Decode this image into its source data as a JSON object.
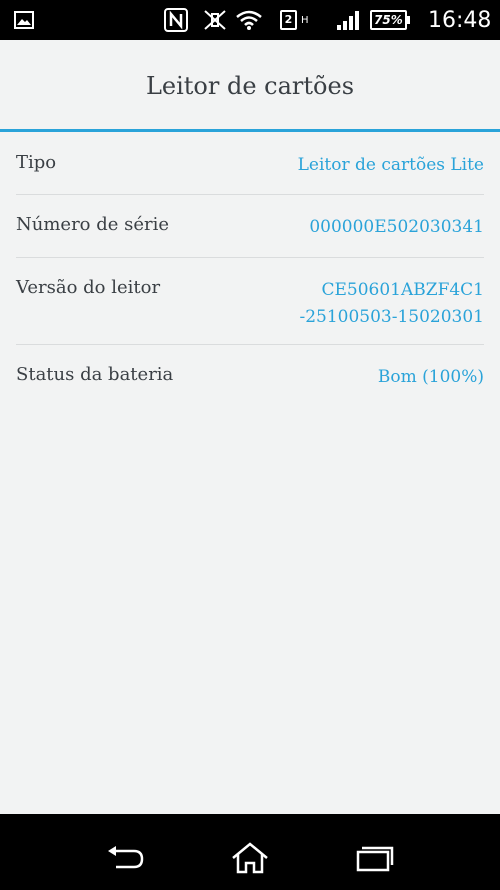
{
  "status_bar": {
    "time": "16:48",
    "battery": "75%",
    "sim": "2",
    "network_type": "H",
    "icons": [
      "gallery-icon",
      "nfc-icon",
      "mute-icon",
      "wifi-icon",
      "sim-icon",
      "signal-icon",
      "battery-icon"
    ]
  },
  "header": {
    "title": "Leitor de cartões"
  },
  "rows": [
    {
      "label": "Tipo",
      "value": "Leitor de cartões Lite"
    },
    {
      "label": "Número de série",
      "value": "000000E502030341"
    },
    {
      "label": "Versão do leitor",
      "value_line1": "CE50601ABZF4C1",
      "value_line2": "-25100503-15020301"
    },
    {
      "label": "Status da bateria",
      "value": "Bom (100%)"
    }
  ],
  "nav_bar": {
    "icons": [
      "back-icon",
      "home-icon",
      "recent-apps-icon"
    ]
  },
  "colors": {
    "accent": "#2aa3d9",
    "text": "#3a3f44",
    "background": "#f2f3f3"
  }
}
